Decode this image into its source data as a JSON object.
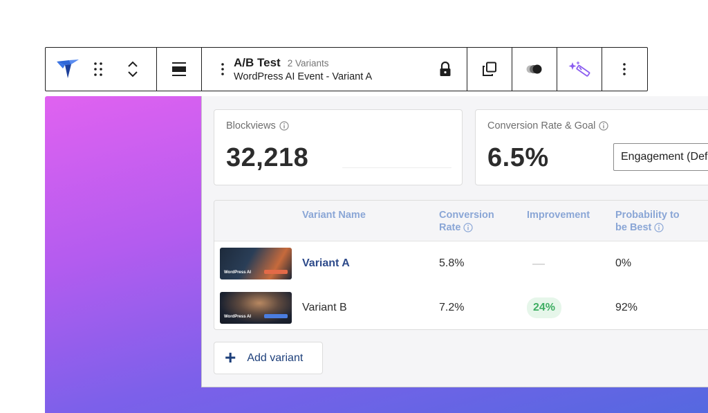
{
  "toolbar": {
    "block_title": "A/B Test",
    "variant_count": "2 Variants",
    "block_subtitle": "WordPress AI Event - Variant A",
    "icons": [
      "plugin-logo-icon",
      "drag-handle-icon",
      "move-up-icon",
      "move-down-icon",
      "align-icon",
      "options-dots-icon",
      "lock-icon",
      "duplicate-icon",
      "toggle-icon",
      "ai-magic-icon",
      "more-icon"
    ]
  },
  "stats": {
    "blockviews_label": "Blockviews",
    "blockviews_value": "32,218",
    "conversion_label": "Conversion Rate & Goal",
    "conversion_value": "6.5%",
    "goal_selected": "Engagement (Default)"
  },
  "table": {
    "headers": {
      "name": "Variant Name",
      "rate_line1": "Conversion",
      "rate_line2": "Rate",
      "improvement": "Improvement",
      "prob_line1": "Probability to",
      "prob_line2": "be Best"
    },
    "rows": [
      {
        "name": "Variant A",
        "rate": "5.8%",
        "improvement": "",
        "probability": "0%",
        "thumb_text": "WordPress AI"
      },
      {
        "name": "Variant B",
        "rate": "7.2%",
        "improvement": "24%",
        "probability": "92%",
        "thumb_text": "WordPress AI"
      }
    ]
  },
  "add_variant_label": "Add variant",
  "colors": {
    "accent_blue": "#2d4a8a",
    "header_blue": "#8aa6d6",
    "positive_green": "#3fae63",
    "magic_purple": "#8a5cf0"
  }
}
